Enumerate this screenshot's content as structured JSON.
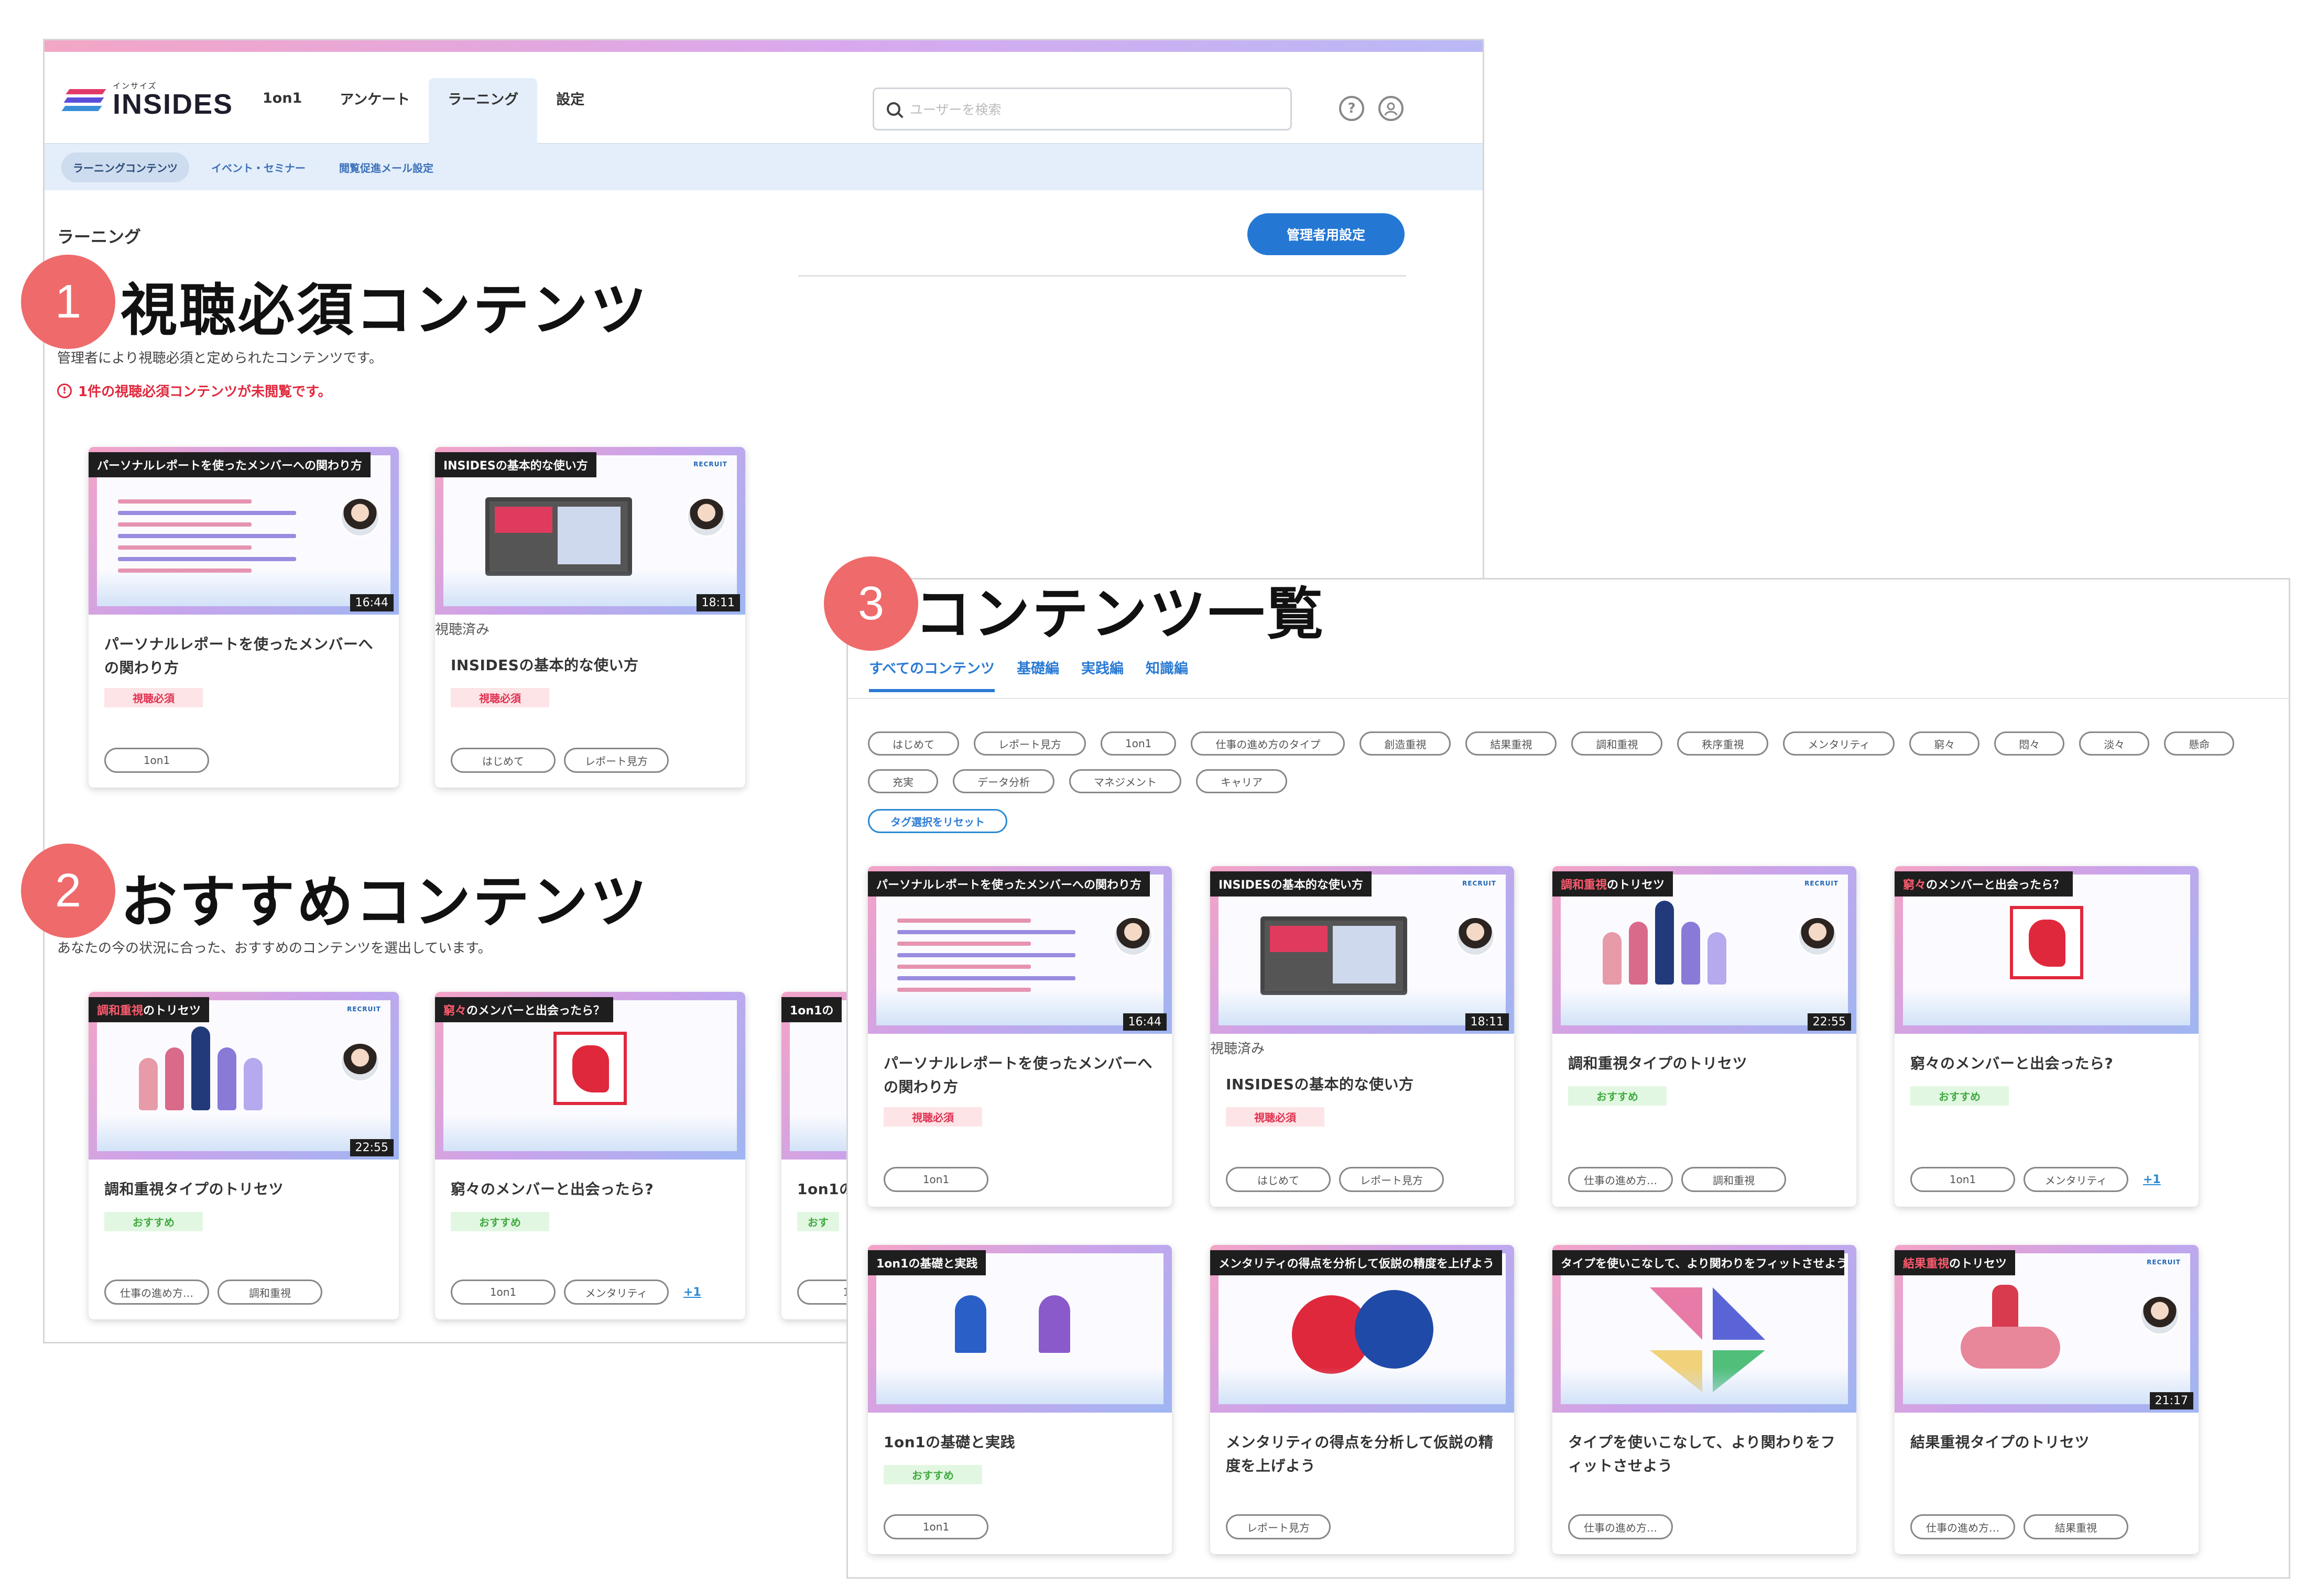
{
  "header": {
    "logo_small": "インサイズ",
    "logo_big": "INSIDES",
    "nav": [
      "1on1",
      "アンケート",
      "ラーニング",
      "設定"
    ],
    "search_placeholder": "ユーザーを検索",
    "help_icon": "help-icon",
    "user_icon": "user-icon"
  },
  "subnav": [
    "ラーニングコンテンツ",
    "イベント・セミナー",
    "閲覧促進メール設定"
  ],
  "page": {
    "breadcrumb": "ラーニング",
    "admin_button": "管理者用設定"
  },
  "sections": {
    "required": {
      "number": "1",
      "title": "視聴必須コンテンツ",
      "desc": "管理者により視聴必須と定められたコンテンツです。",
      "alert": "1件の視聴必須コンテンツが未閲覧です。"
    },
    "recommended": {
      "number": "2",
      "title": "おすすめコンテンツ",
      "desc": "あなたの今の状況に合った、おすすめのコンテンツを選出しています。"
    },
    "all": {
      "number": "3",
      "title": "コンテンツ一覧"
    }
  },
  "labels": {
    "viewed": "視聴済み",
    "required_badge": "視聴必須",
    "recommended_badge": "おすすめ",
    "more": "+1"
  },
  "required_cards": [
    {
      "thumb_title": "パーソナルレポートを使ったメンバーへの関わり方",
      "duration": "16:44",
      "title": "パーソナルレポートを使ったメンバーへの関わり方",
      "tags": [
        "1on1"
      ]
    },
    {
      "thumb_title": "INSIDESの基本的な使い方",
      "duration": "18:11",
      "title": "INSIDESの基本的な使い方",
      "tags": [
        "はじめて",
        "レポート見方"
      ]
    }
  ],
  "recommended_cards": [
    {
      "thumb_hl": "調和重視",
      "thumb_rest": "のトリセツ",
      "duration": "22:55",
      "title": "調和重視タイプのトリセツ",
      "tags": [
        "仕事の進め方…",
        "調和重視"
      ]
    },
    {
      "thumb_hl": "窮々",
      "thumb_rest": "のメンバーと出会ったら？",
      "title": "窮々のメンバーと出会ったら?",
      "tags": [
        "1on1",
        "メンタリティ"
      ]
    },
    {
      "thumb_title": "1on1の",
      "title": "1on1の",
      "badge": "おす",
      "tags": [
        "1o"
      ]
    }
  ],
  "tabs": [
    "すべてのコンテンツ",
    "基礎編",
    "実践編",
    "知識編"
  ],
  "filter_tags": [
    "はじめて",
    "レポート見方",
    "1on1",
    "仕事の進め方のタイプ",
    "創造重視",
    "結果重視",
    "調和重視",
    "秩序重視",
    "メンタリティ",
    "窮々",
    "悶々",
    "淡々",
    "懸命",
    "充実",
    "データ分析",
    "マネジメント",
    "キャリア"
  ],
  "reset_label": "タグ選択をリセット",
  "all_cards": [
    {
      "thumb_title": "パーソナルレポートを使ったメンバーへの関わり方",
      "duration": "16:44",
      "title": "パーソナルレポートを使ったメンバーへの関わり方",
      "badge": "視聴必須",
      "tags": [
        "1on1"
      ]
    },
    {
      "thumb_title": "INSIDESの基本的な使い方",
      "duration": "18:11",
      "title": "INSIDESの基本的な使い方",
      "badge": "視聴必須",
      "tags": [
        "はじめて",
        "レポート見方"
      ]
    },
    {
      "thumb_hl": "調和重視",
      "thumb_rest": "のトリセツ",
      "duration": "22:55",
      "title": "調和重視タイプのトリセツ",
      "badge": "おすすめ",
      "tags": [
        "仕事の進め方…",
        "調和重視"
      ]
    },
    {
      "thumb_hl": "窮々",
      "thumb_rest": "のメンバーと出会ったら？",
      "title": "窮々のメンバーと出会ったら?",
      "badge": "おすすめ",
      "tags": [
        "1on1",
        "メンタリティ"
      ]
    },
    {
      "thumb_title": "1on1の基礎と実践",
      "title": "1on1の基礎と実践",
      "badge": "おすすめ",
      "tags": [
        "1on1"
      ]
    },
    {
      "thumb_title": "メンタリティの得点を分析して仮説の精度を上げよう",
      "title": "メンタリティの得点を分析して仮説の精度を上げよう",
      "tags": [
        "レポート見方"
      ]
    },
    {
      "thumb_title": "タイプを使いこなして、より関わりをフィットさせよう",
      "title": "タイプを使いこなして、より関わりをフィットさせよう",
      "tags": [
        "仕事の進め方…"
      ]
    },
    {
      "thumb_hl": "結果重視",
      "thumb_rest": "のトリセツ",
      "duration": "21:17",
      "title": "結果重視タイプのトリセツ",
      "tags": [
        "仕事の進め方…",
        "結果重視"
      ]
    }
  ]
}
